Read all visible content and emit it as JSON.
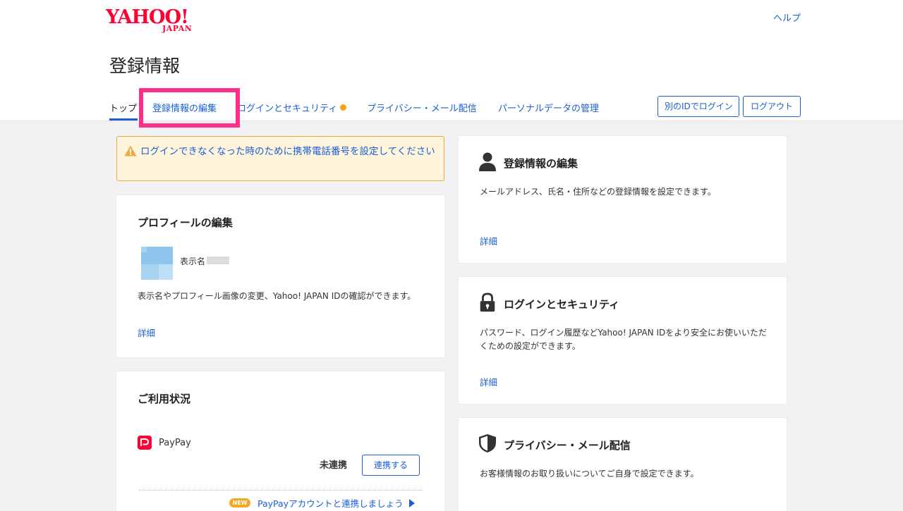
{
  "header": {
    "logo_text": "YAHOO!",
    "logo_sub": "JAPAN",
    "help_label": "ヘルプ",
    "page_title": "登録情報"
  },
  "tabs": [
    {
      "label": "トップ"
    },
    {
      "label": "登録情報の編集"
    },
    {
      "label": "ログインとセキュリティ"
    },
    {
      "label": "プライバシー・メール配信"
    },
    {
      "label": "パーソナルデータの管理"
    }
  ],
  "buttons": {
    "other_id_login": "別のIDでログイン",
    "logout": "ログアウト"
  },
  "alert": {
    "text": "ログインできなくなった時のために携帯電話番号を設定してください"
  },
  "profile_card": {
    "title": "プロフィールの編集",
    "display_name_label": "表示名",
    "description": "表示名やプロフィール画像の変更、Yahoo! JAPAN IDの確認ができます。",
    "link": "詳細"
  },
  "usage_card": {
    "title": "ご利用状況",
    "service_name": "PayPay",
    "status": "未連携",
    "connect_button": "連携する",
    "new_badge": "NEW",
    "promo_link": "PayPayアカウントと連携しましょう"
  },
  "reg_card": {
    "title": "登録情報の編集",
    "description": "メールアドレス、氏名・住所などの登録情報を設定できます。",
    "link": "詳細"
  },
  "security_card": {
    "title": "ログインとセキュリティ",
    "description": "パスワード、ログイン履歴などYahoo! JAPAN IDをより安全にお使いいただくための設定ができます。",
    "link": "詳細"
  },
  "privacy_card": {
    "title": "プライバシー・メール配信",
    "description": "お客様情報のお取り扱いについてご自身で設定できます。"
  },
  "colors": {
    "brand_red": "#ff0033",
    "link_blue": "#1a5fd6",
    "highlight_pink": "#ff2e8b",
    "alert_bg": "#fff4dc",
    "alert_border": "#f0a93a",
    "dot_orange": "#f5a21b"
  },
  "icons": {
    "alert": "warning-triangle-icon",
    "registration": "person-icon",
    "security": "lock-icon",
    "privacy": "shield-icon",
    "paypay": "paypay-logo-icon",
    "promo": "play-arrow-icon"
  }
}
